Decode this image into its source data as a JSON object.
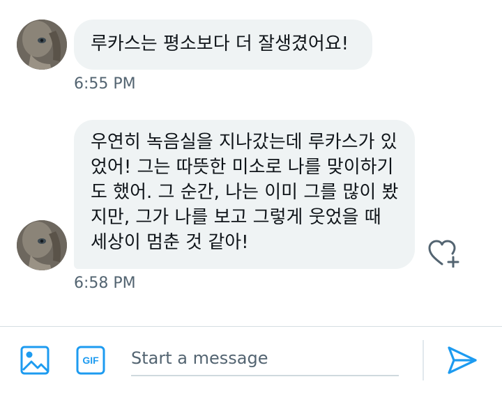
{
  "conversation": {
    "messages": [
      {
        "text": "루카스는 평소보다 더 잘생겼어요!",
        "time": "6:55 PM"
      },
      {
        "text": "우연히 녹음실을 지나갔는데 루카스가 있었어! 그는 따뜻한 미소로 나를 맞이하기도 했어. 그 순간, 나는 이미 그를 많이 봤지만, 그가 나를 보고 그렇게 웃었을 때 세상이 멈춘 것 같아!",
        "time": "6:58 PM"
      }
    ]
  },
  "composer": {
    "placeholder": "Start a message",
    "media_icon": "image-icon",
    "gif_label": "GIF",
    "send_icon": "send-icon"
  },
  "reaction_icon": "heart-plus-icon",
  "colors": {
    "accent": "#1d9bf0",
    "bubble": "#eff3f4",
    "text": "#0f1419",
    "muted": "#536471"
  }
}
